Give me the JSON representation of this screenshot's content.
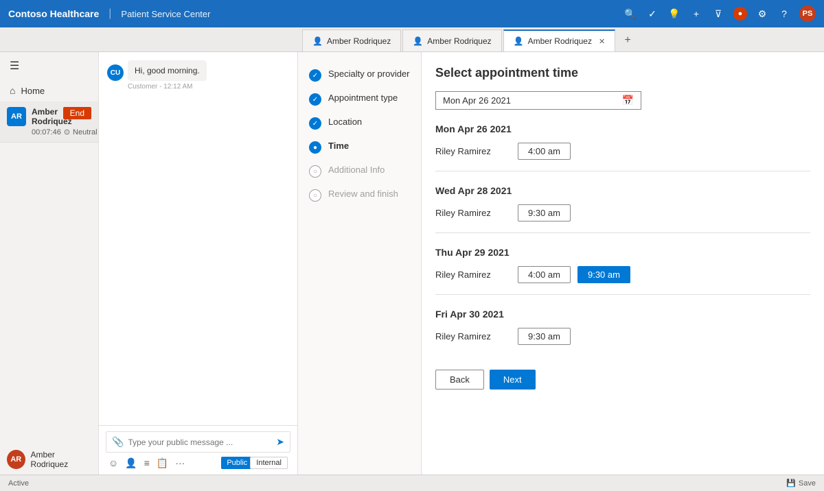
{
  "topbar": {
    "brand": "Contoso Healthcare",
    "divider": "|",
    "subtitle": "Patient Service Center",
    "icons": [
      "search",
      "check-circle",
      "lightbulb",
      "plus",
      "filter",
      "settings",
      "help"
    ],
    "avatar_label": "PS"
  },
  "tabs": [
    {
      "id": "tab1",
      "label": "Amber Rodriquez",
      "active": false,
      "icon": "person"
    },
    {
      "id": "tab2",
      "label": "Amber Rodriquez",
      "active": false,
      "icon": "person"
    },
    {
      "id": "tab3",
      "label": "Amber Rodriquez",
      "active": true,
      "icon": "person"
    }
  ],
  "sidebar": {
    "items": [
      {
        "id": "home",
        "label": "Home",
        "icon": "⌂"
      }
    ]
  },
  "conversation": {
    "contact_name": "Amber Rodriquez",
    "duration": "00:07:46",
    "sentiment": "Neutral",
    "end_label": "End",
    "agent_name": "Amber Rodriquez",
    "agent_initials": "AR"
  },
  "chat": {
    "message_text": "Hi, good morning.",
    "message_sender": "Customer - 12:12 AM",
    "input_placeholder": "Type your public message ...",
    "attach_icon": "📎",
    "send_icon": "➤",
    "public_label": "Public",
    "internal_label": "Internal"
  },
  "wizard": {
    "steps": [
      {
        "id": "specialty",
        "label": "Specialty or provider",
        "state": "done"
      },
      {
        "id": "appointment_type",
        "label": "Appointment type",
        "state": "done"
      },
      {
        "id": "location",
        "label": "Location",
        "state": "done"
      },
      {
        "id": "time",
        "label": "Time",
        "state": "active"
      },
      {
        "id": "additional_info",
        "label": "Additional Info",
        "state": "pending"
      },
      {
        "id": "review",
        "label": "Review and finish",
        "state": "pending"
      }
    ]
  },
  "appointment": {
    "title": "Select appointment time",
    "date_value": "Mon Apr 26 2021",
    "days": [
      {
        "label": "Mon Apr 26 2021",
        "slots": [
          {
            "provider": "Riley Ramirez",
            "times": [
              "4:00 am"
            ]
          }
        ]
      },
      {
        "label": "Wed Apr 28 2021",
        "slots": [
          {
            "provider": "Riley Ramirez",
            "times": [
              "9:30 am"
            ]
          }
        ]
      },
      {
        "label": "Thu Apr 29 2021",
        "slots": [
          {
            "provider": "Riley Ramirez",
            "times": [
              "4:00 am",
              "9:30 am"
            ]
          }
        ],
        "selected_time": "9:30 am"
      },
      {
        "label": "Fri Apr 30 2021",
        "slots": [
          {
            "provider": "Riley Ramirez",
            "times": [
              "9:30 am"
            ]
          }
        ]
      }
    ],
    "back_label": "Back",
    "next_label": "Next"
  },
  "statusbar": {
    "status": "Active",
    "save_label": "Save"
  }
}
